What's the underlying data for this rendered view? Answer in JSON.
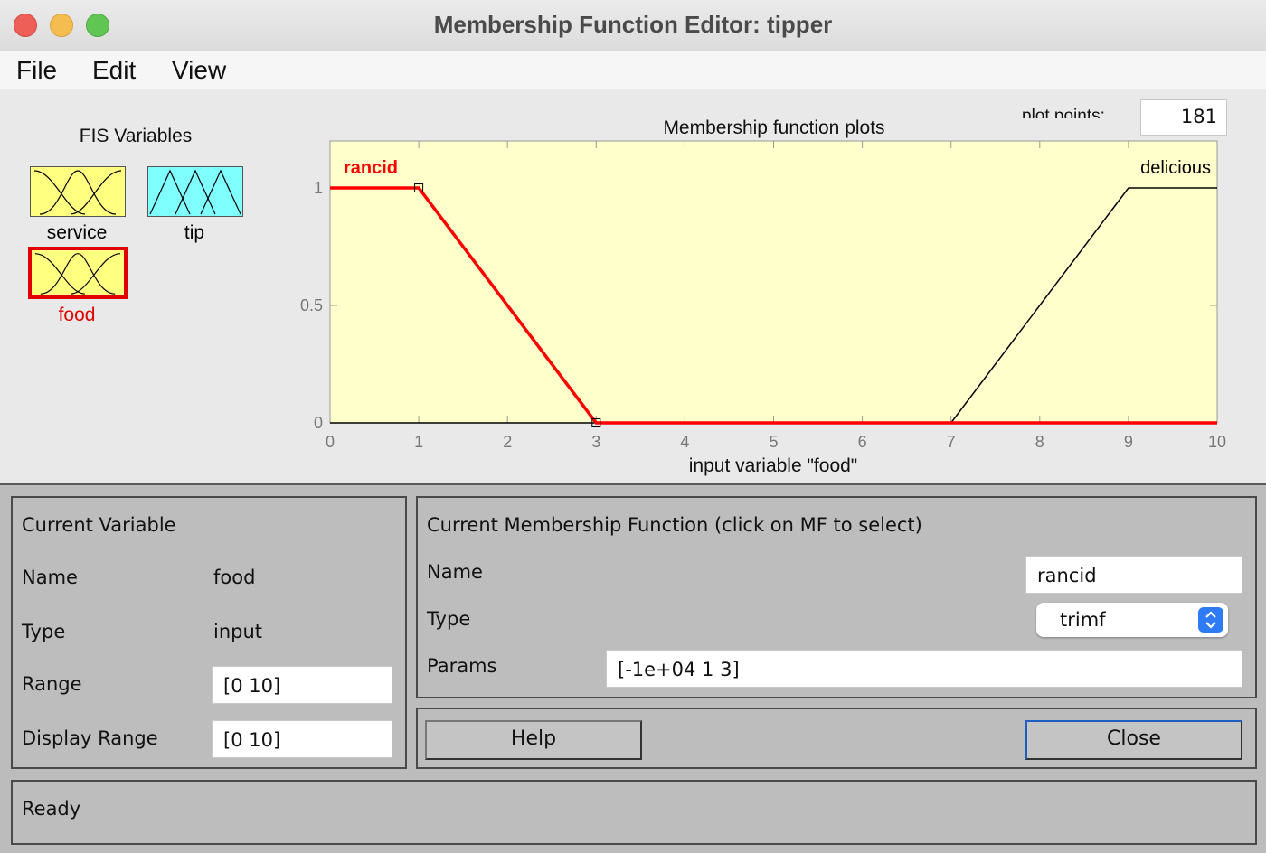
{
  "window": {
    "title": "Membership Function Editor: tipper",
    "menu": [
      "File",
      "Edit",
      "View"
    ]
  },
  "fis": {
    "heading": "FIS Variables",
    "variables": [
      {
        "name": "service",
        "color": "#ffff80",
        "selected": false
      },
      {
        "name": "tip",
        "color": "#80ffff",
        "selected": false
      },
      {
        "name": "food",
        "color": "#ffff80",
        "selected": true
      }
    ]
  },
  "plot": {
    "plot_points_label": "plot points:",
    "plot_points_value": "181"
  },
  "chart_data": {
    "type": "line",
    "title": "Membership function plots",
    "xlabel": "input variable \"food\"",
    "ylabel": "",
    "xlim": [
      0,
      10
    ],
    "ylim": [
      0,
      1.2
    ],
    "xticks": [
      "0",
      "1",
      "2",
      "3",
      "4",
      "5",
      "6",
      "7",
      "8",
      "9",
      "10"
    ],
    "yticks": [
      "0",
      "0.5",
      "1"
    ],
    "background": "#ffffcc",
    "series": [
      {
        "name": "rancid",
        "color": "#ff0000",
        "selected": true,
        "x": [
          0,
          1,
          3,
          10
        ],
        "y": [
          1,
          1,
          0,
          0
        ]
      },
      {
        "name": "delicious",
        "color": "#000000",
        "selected": false,
        "x": [
          0,
          7,
          9,
          10
        ],
        "y": [
          0,
          0,
          1,
          1
        ]
      }
    ]
  },
  "current_variable": {
    "heading": "Current Variable",
    "name_label": "Name",
    "name_value": "food",
    "type_label": "Type",
    "type_value": "input",
    "range_label": "Range",
    "range_value": "[0 10]",
    "display_range_label": "Display Range",
    "display_range_value": "[0 10]"
  },
  "current_mf": {
    "heading": "Current Membership Function (click on MF to select)",
    "name_label": "Name",
    "name_value": "rancid",
    "type_label": "Type",
    "type_value": "trimf",
    "params_label": "Params",
    "params_value": "[-1e+04 1 3]"
  },
  "buttons": {
    "help": "Help",
    "close": "Close"
  },
  "status": "Ready"
}
